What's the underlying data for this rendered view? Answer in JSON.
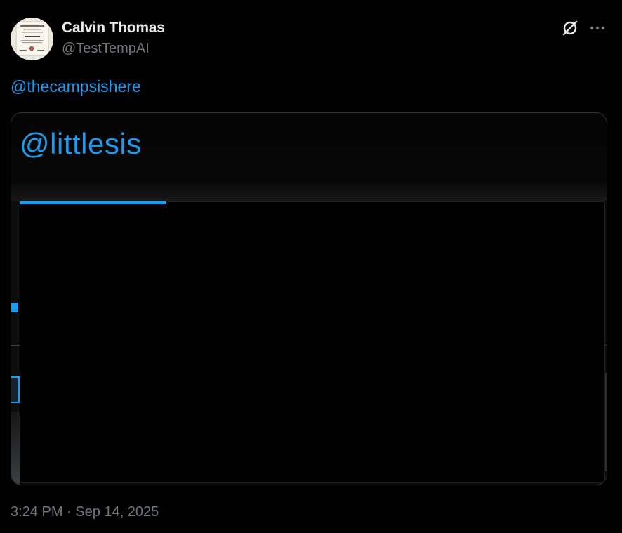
{
  "author": {
    "display_name": "Calvin Thomas",
    "handle": "@TestTempAI",
    "avatar_icon": "certificate-avatar"
  },
  "actions": {
    "grok_icon": "grok-icon",
    "more_icon": "more-icon"
  },
  "tweet": {
    "text": "@thecampsishere"
  },
  "media": {
    "overlay_text": "@littlesis",
    "progress": 0.25
  },
  "meta": {
    "timestamp": "3:24 PM · Sep 14, 2025"
  },
  "colors": {
    "background": "#000000",
    "accent": "#1d9bf0",
    "primary_text": "#e7e9ea",
    "secondary_text": "#71767b",
    "border": "#2f3336"
  }
}
